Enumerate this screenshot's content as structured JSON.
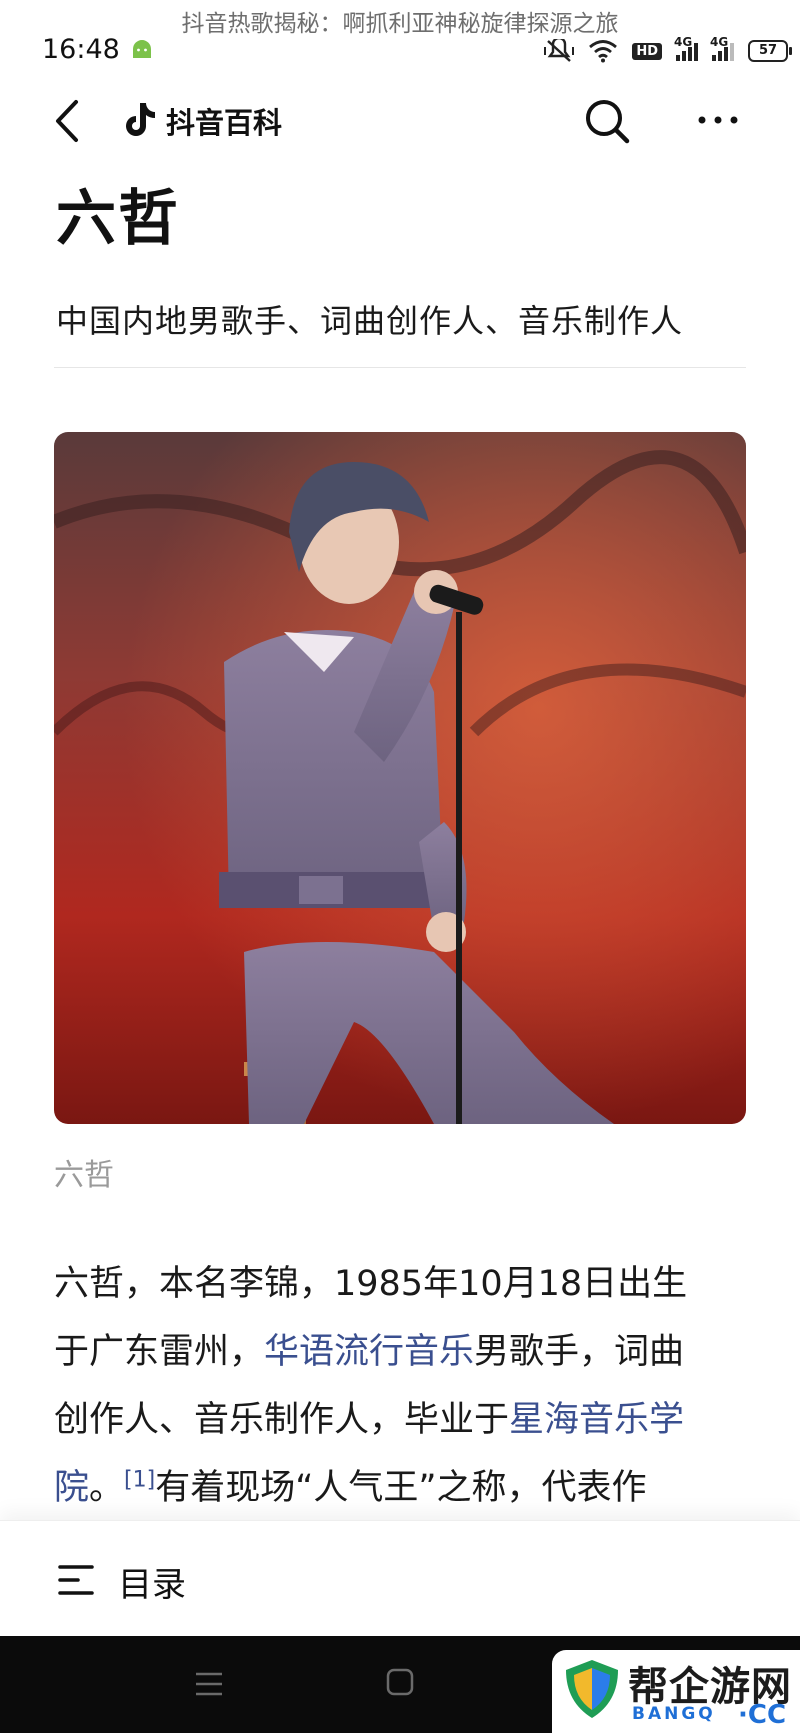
{
  "overlay_caption": "抖音热歌揭秘：啊抓利亚神秘旋律探源之旅",
  "status_bar": {
    "time": "16:48",
    "hd_label": "HD",
    "signal_1_label": "4G",
    "signal_2_label": "4G",
    "battery": "57"
  },
  "header": {
    "app_title": "抖音百科",
    "icons": [
      "back-icon",
      "douyin-logo-icon",
      "search-icon",
      "more-icon"
    ]
  },
  "entry": {
    "title": "六哲",
    "subtitle": "中国内地男歌手、词曲创作人、音乐制作人",
    "image_caption": "六哲"
  },
  "intro": {
    "line1": "六哲，本名李锦，1985年10月18日出生",
    "line2_pre": "于广东雷州，",
    "line2_link": "华语流行音乐",
    "line2_post": "男歌手，词曲",
    "line3_pre": "创作人、音乐制作人，毕业于",
    "line3_link": "星海音乐学",
    "line4_link": "院",
    "line4_punct": "。",
    "line4_cite": "[1]",
    "line4_post": "有着现场“人气王”之称，代表作"
  },
  "toc": {
    "label": "目录"
  },
  "watermark": {
    "text": "帮企游网",
    "sub": "BANGQ",
    "cc": "·CC"
  },
  "colors": {
    "link": "#3a4f8f",
    "caption_gray": "#9a9a9a",
    "watermark_blue": "#1f6fd6"
  }
}
